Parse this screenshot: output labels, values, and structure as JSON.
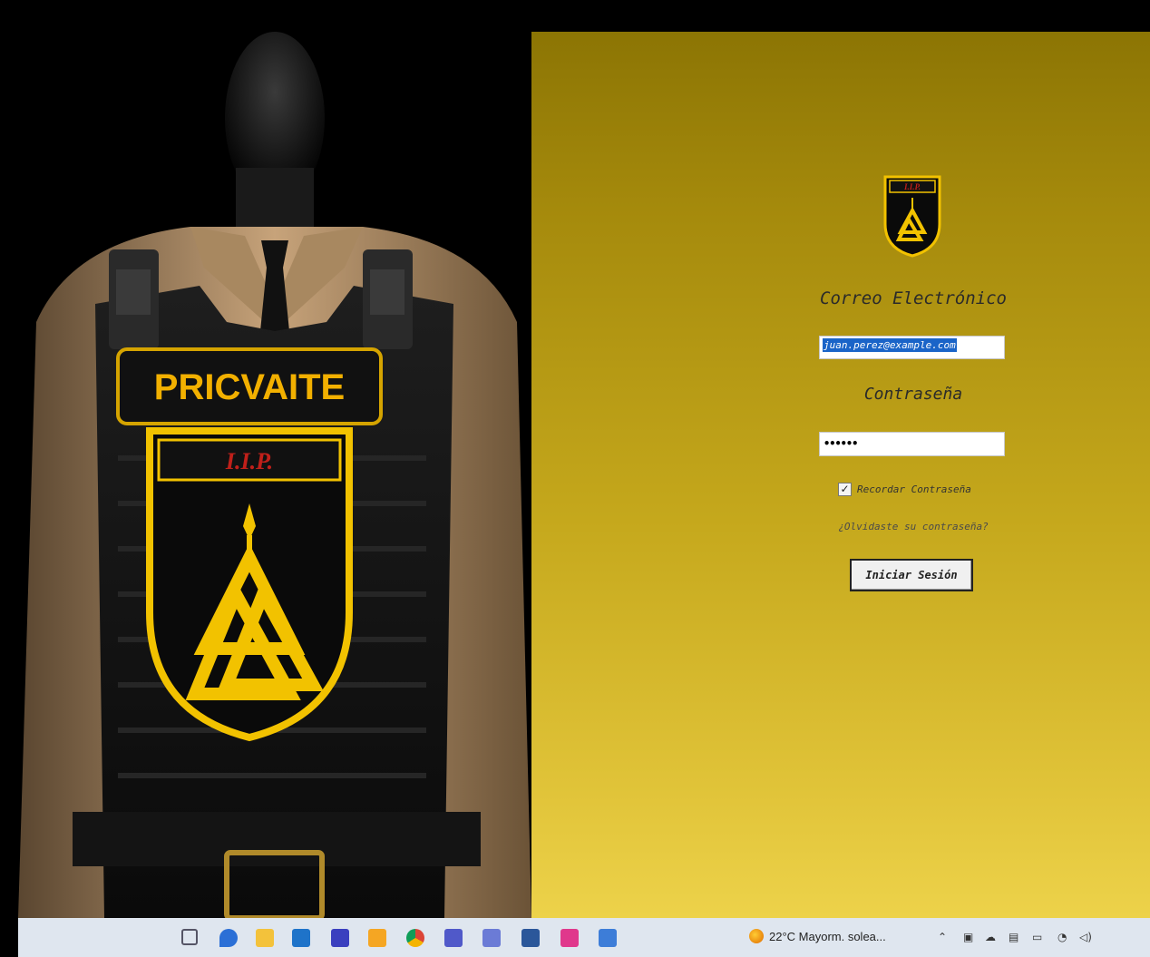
{
  "login": {
    "email_label": "Correo Electrónico",
    "email_value": "juan.perez@example.com",
    "password_label": "Contraseña",
    "password_masked": "••••••",
    "remember_label": "Recordar Contraseña",
    "remember_checked": true,
    "forgot_link": "¿Olvidaste su contraseña?",
    "submit_label": "Iniciar Sesión"
  },
  "poster": {
    "vest_patch_text": "PRICVAITE",
    "badge_text": "I.I.P."
  },
  "logo": {
    "badge_text": "I.I.P."
  },
  "taskbar": {
    "apps": [
      "task-view-icon",
      "chat-icon",
      "file-explorer-icon",
      "mail-icon",
      "editor-icon",
      "store-icon",
      "chrome-icon",
      "teams-icon",
      "app-icon",
      "word-icon",
      "ide-icon",
      "photos-icon"
    ],
    "weather": "22°C  Mayorm. solea...",
    "tray": [
      "chevron-up-icon",
      "network-icon",
      "cloud-icon",
      "display-icon",
      "battery-icon",
      "wifi-icon",
      "volume-icon"
    ]
  },
  "colors": {
    "panel_top": "#8c7504",
    "panel_bottom": "#edd24a",
    "badge_yellow": "#f2c200",
    "badge_red": "#c0201a"
  }
}
